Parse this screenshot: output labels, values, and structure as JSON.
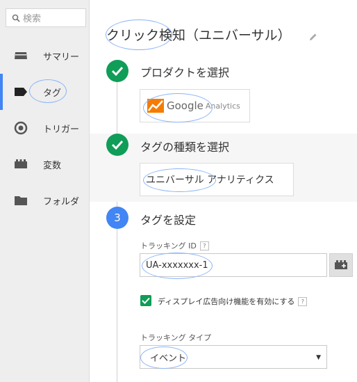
{
  "sidebar": {
    "search_placeholder": "検索",
    "items": [
      {
        "label": "サマリー",
        "icon": "summary-icon"
      },
      {
        "label": "タグ",
        "icon": "tag-icon",
        "active": true
      },
      {
        "label": "トリガー",
        "icon": "trigger-icon"
      },
      {
        "label": "変数",
        "icon": "variables-icon"
      },
      {
        "label": "フォルダ",
        "icon": "folder-icon"
      }
    ]
  },
  "main": {
    "title": "クリック検知（ユニバーサル）",
    "steps": [
      {
        "label": "プロダクトを選択",
        "state": "done",
        "product": {
          "google": "Google",
          "analytics": "Analytics"
        }
      },
      {
        "label": "タグの種類を選択",
        "state": "done",
        "tag_type": {
          "part1": "ユニバーサル",
          "part2": " アナリティクス"
        }
      },
      {
        "label": "タグを設定",
        "state": "current",
        "number": "3"
      }
    ],
    "tracking_id": {
      "label": "トラッキング ID",
      "help": "?",
      "value": "UA-xxxxxxx-1"
    },
    "display_ads": {
      "label": "ディスプレイ広告向け機能を有効にする",
      "checked": true,
      "help": "?"
    },
    "tracking_type": {
      "label": "トラッキング タイプ",
      "selected": "イベント"
    }
  },
  "colors": {
    "accent": "#4285f4",
    "success": "#0f9d58",
    "ga_orange": "#f57c00",
    "annotation": "#8ab4f8"
  }
}
